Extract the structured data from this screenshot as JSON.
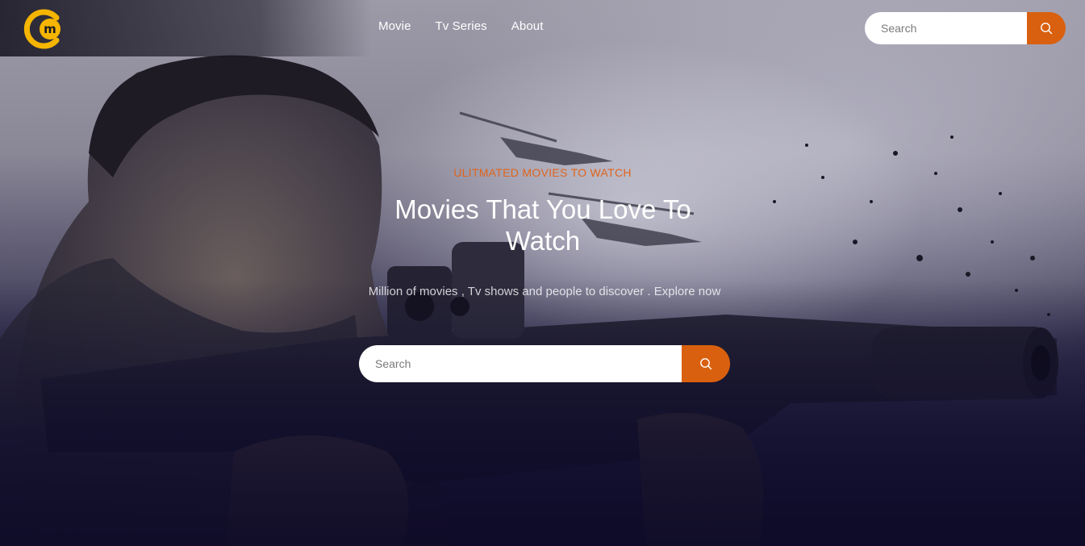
{
  "brand": {
    "logo_icon": "cm-logo-icon",
    "accent": "#d9600e",
    "logo_color": "#f5b500"
  },
  "nav": {
    "items": [
      {
        "label": "Movie"
      },
      {
        "label": "Tv Series"
      },
      {
        "label": "About"
      }
    ]
  },
  "header_search": {
    "placeholder": "Search",
    "button_icon": "search-icon"
  },
  "hero": {
    "eyebrow": "ULITMATED MOVIES TO WATCH",
    "title": "Movies That You Love To Watch",
    "subtitle": "Million of movies , Tv shows and people to discover . Explore now",
    "search_placeholder": "Search",
    "search_icon": "search-icon"
  }
}
